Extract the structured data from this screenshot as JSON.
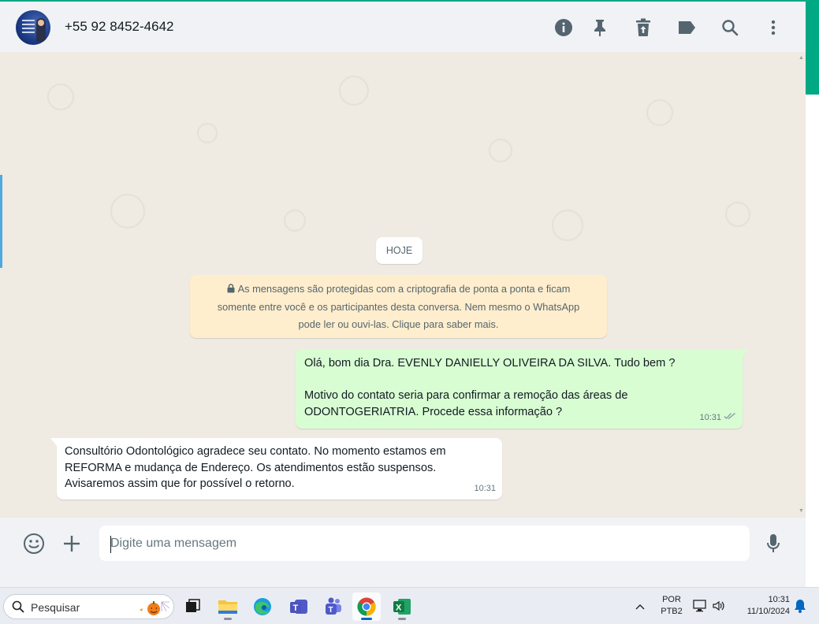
{
  "header": {
    "contact_name": "+55 92 8452-4642",
    "icons": [
      "info-icon",
      "pin-icon",
      "delete-icon",
      "label-icon",
      "search-icon",
      "menu-icon"
    ]
  },
  "chat": {
    "date_chip": "HOJE",
    "encryption_notice": {
      "lines": [
        "As mensagens são protegidas com a criptografia de ponta a ponta e ficam",
        "somente entre você e os participantes desta conversa. Nem mesmo o WhatsApp",
        "pode ler ou ouvi-las. Clique para saber mais."
      ]
    },
    "messages": [
      {
        "direction": "outgoing",
        "lines": [
          "Olá, bom dia Dra. EVENLY DANIELLY OLIVEIRA DA SILVA. Tudo bem ?",
          "",
          "Motivo do contato seria para confirmar a remoção das áreas de",
          "ODONTOGERIATRIA. Procede essa informação ?"
        ],
        "time": "10:31",
        "status": "read"
      },
      {
        "direction": "incoming",
        "lines": [
          "Consultório Odontológico agradece seu contato.  No momento estamos em",
          "REFORMA e mudança de Endereço. Os atendimentos estão suspensos.",
          "Avisaremos assim que for possível o retorno."
        ],
        "time": "10:31"
      }
    ]
  },
  "composer": {
    "placeholder": "Digite uma mensagem",
    "value": ""
  },
  "taskbar": {
    "search_label": "Pesquisar",
    "language": "POR",
    "keyboard": "PTB2",
    "time": "10:31",
    "date": "11/10/2024",
    "apps": [
      "task-view",
      "file-explorer",
      "edge",
      "teams-work",
      "teams",
      "chrome",
      "excel"
    ],
    "active_app": "chrome"
  },
  "colors": {
    "accent": "#00a884",
    "outgoing_bubble": "#d9fdd3",
    "incoming_bubble": "#ffffff",
    "notice_bg": "#ffeecd",
    "chat_bg": "#efeae2",
    "read_ticks": "#667781"
  }
}
